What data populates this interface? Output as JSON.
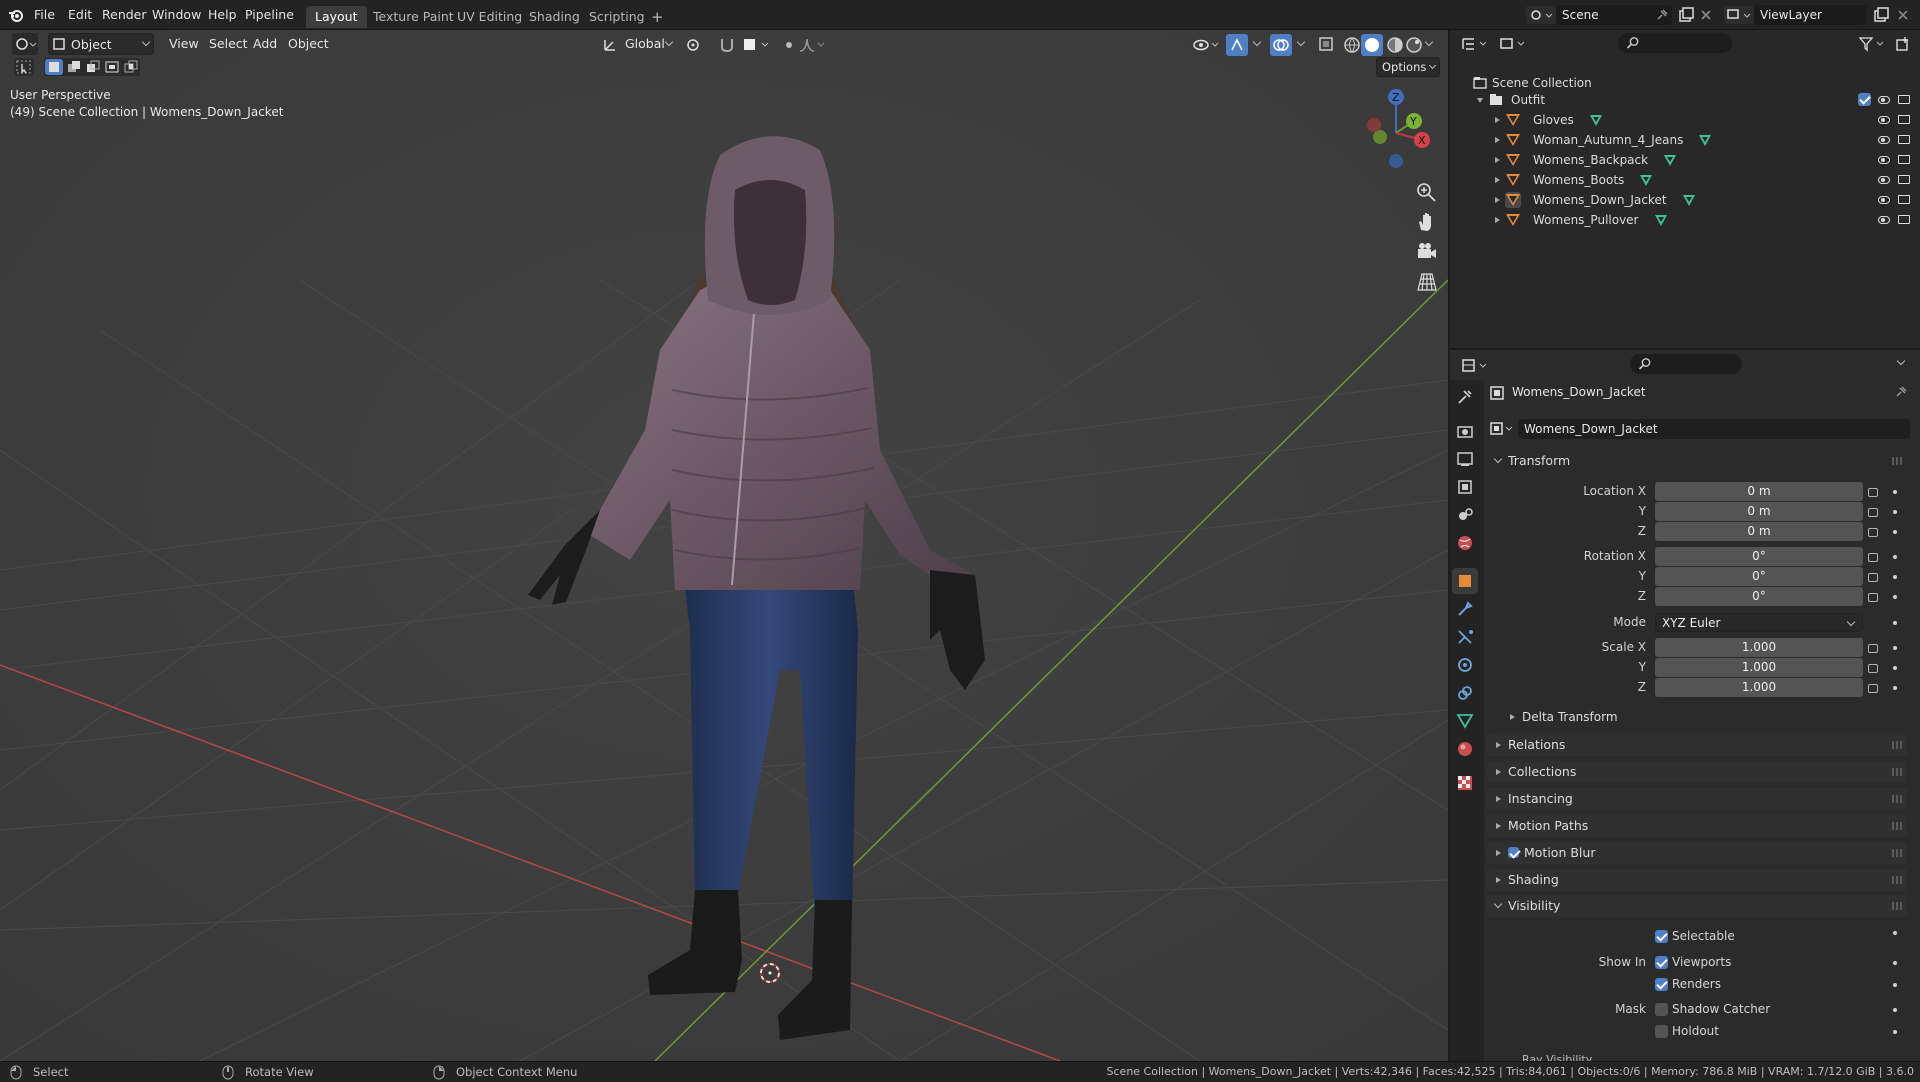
{
  "topbar": {
    "menus": [
      "File",
      "Edit",
      "Render",
      "Window",
      "Help",
      "Pipeline"
    ],
    "workspaces": [
      "Layout",
      "Texture Paint",
      "UV Editing",
      "Shading",
      "Scripting"
    ],
    "add_tab": "+",
    "scene_name": "Scene",
    "view_layer": "ViewLayer"
  },
  "viewport": {
    "mode": "Object Mode",
    "menus": [
      "View",
      "Select",
      "Add",
      "Object"
    ],
    "orientation": "Global",
    "options": "Options",
    "perspective": "User Perspective",
    "collection_info": "(49) Scene Collection | Womens_Down_Jacket",
    "gizmo": {
      "z": "Z",
      "y": "Y",
      "x": "X"
    }
  },
  "outliner": {
    "root": "Scene Collection",
    "collection": "Outfit",
    "objects": [
      "Gloves",
      "Woman_Autumn_4_Jeans",
      "Womens_Backpack",
      "Womens_Boots",
      "Womens_Down_Jacket",
      "Womens_Pullover"
    ],
    "active_object": "Womens_Down_Jacket"
  },
  "properties": {
    "object_name": "Womens_Down_Jacket",
    "datablock_name": "Womens_Down_Jacket",
    "transform": {
      "title": "Transform",
      "location_label": "Location X",
      "rotation_label": "Rotation X",
      "scale_label": "Scale X",
      "y_label": "Y",
      "z_label": "Z",
      "location": [
        "0 m",
        "0 m",
        "0 m"
      ],
      "rotation": [
        "0°",
        "0°",
        "0°"
      ],
      "mode_label": "Mode",
      "mode": "XYZ Euler",
      "scale": [
        "1.000",
        "1.000",
        "1.000"
      ],
      "delta": "Delta Transform"
    },
    "panels": [
      "Relations",
      "Collections",
      "Instancing",
      "Motion Paths",
      "Motion Blur",
      "Shading"
    ],
    "visibility": {
      "title": "Visibility",
      "selectable": "Selectable",
      "show_in": "Show In",
      "viewports": "Viewports",
      "renders": "Renders",
      "mask": "Mask",
      "shadow_catcher": "Shadow Catcher",
      "holdout": "Holdout",
      "ray_visibility": "Ray Visibility"
    }
  },
  "statusbar": {
    "select": "Select",
    "rotate": "Rotate View",
    "context": "Object Context Menu",
    "stats": "Scene Collection | Womens_Down_Jacket | Verts:42,346 | Faces:42,525 | Tris:84,061 | Objects:0/6 | Memory: 786.8 MiB | VRAM: 1.7/12.0 GiB | 3.6.0"
  },
  "colors": {
    "accent": "#4f7fc4",
    "x_axis": "#b54848",
    "y_axis": "#6f9a30",
    "mesh_icon": "#e58a3b",
    "data_icon": "#3fc19c"
  }
}
